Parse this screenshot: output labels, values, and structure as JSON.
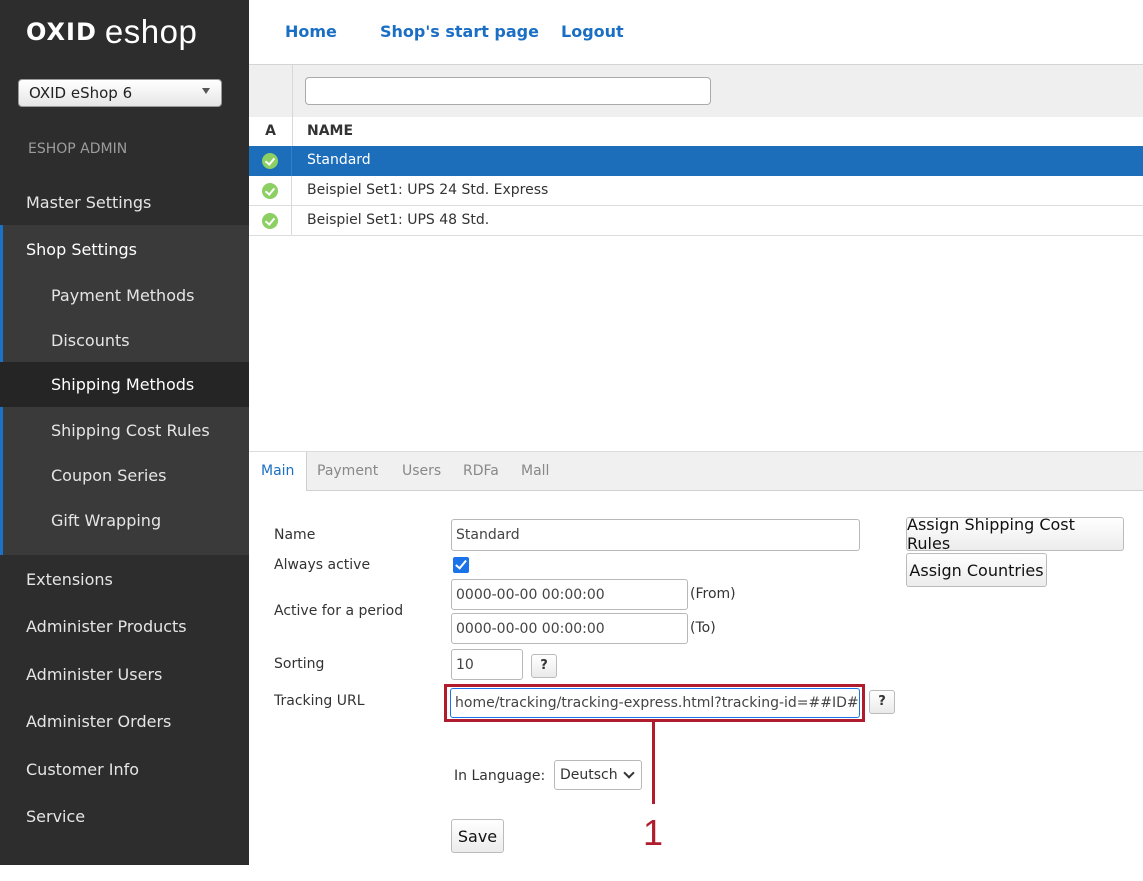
{
  "brand": {
    "part1": "OXID",
    "part2": "eshop"
  },
  "shop_selector": {
    "value": "OXID eShop 6"
  },
  "sidebar": {
    "section_label": "ESHOP ADMIN",
    "items": [
      {
        "label": "Master Settings"
      },
      {
        "label": "Shop Settings"
      },
      {
        "label": "Extensions"
      },
      {
        "label": "Administer Products"
      },
      {
        "label": "Administer Users"
      },
      {
        "label": "Administer Orders"
      },
      {
        "label": "Customer Info"
      },
      {
        "label": "Service"
      }
    ],
    "sub_items": [
      {
        "label": "Payment Methods"
      },
      {
        "label": "Discounts"
      },
      {
        "label": "Shipping Methods"
      },
      {
        "label": "Shipping Cost Rules"
      },
      {
        "label": "Coupon Series"
      },
      {
        "label": "Gift Wrapping"
      }
    ]
  },
  "topnav": {
    "home": "Home",
    "start_page": "Shop's start page",
    "logout": "Logout"
  },
  "list": {
    "filter_value": "",
    "columns": {
      "active": "A",
      "name": "NAME"
    },
    "rows": [
      {
        "name": "Standard",
        "selected": true
      },
      {
        "name": "Beispiel Set1: UPS 24 Std. Express",
        "selected": false
      },
      {
        "name": "Beispiel Set1: UPS 48 Std.",
        "selected": false
      }
    ]
  },
  "tabs": [
    {
      "label": "Main"
    },
    {
      "label": "Payment"
    },
    {
      "label": "Users"
    },
    {
      "label": "RDFa"
    },
    {
      "label": "Mall"
    }
  ],
  "form": {
    "name_label": "Name",
    "name_value": "Standard",
    "always_active_label": "Always active",
    "always_active_checked": true,
    "period_label": "Active for a period",
    "from_value": "0000-00-00 00:00:00",
    "from_suffix": "(From)",
    "to_value": "0000-00-00 00:00:00",
    "to_suffix": "(To)",
    "sorting_label": "Sorting",
    "sorting_value": "10",
    "help_label": "?",
    "tracking_label": "Tracking URL",
    "tracking_value": "home/tracking/tracking-express.html?tracking-id=##ID##",
    "language_label": "In Language:",
    "language_value": "Deutsch",
    "save_label": "Save",
    "assign_rules_label": "Assign Shipping Cost Rules",
    "assign_countries_label": "Assign Countries"
  },
  "annotation": {
    "number": "1",
    "color": "#b01c2e"
  },
  "colors": {
    "sidebar_bg": "#2d2d2d",
    "accent": "#1a6fc4",
    "selected_row": "#1c6dba"
  }
}
